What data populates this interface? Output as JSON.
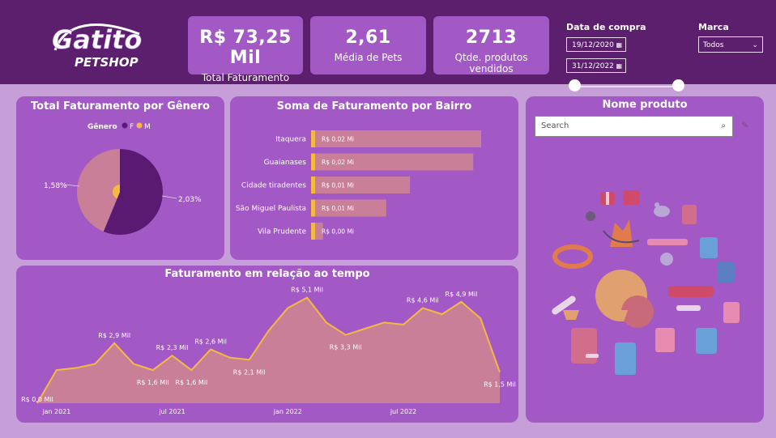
{
  "brand": {
    "name": "Gatito",
    "subname": "PETSHOP"
  },
  "kpis": [
    {
      "value": "R$ 73,25 Mil",
      "label": "Total Faturamento"
    },
    {
      "value": "2,61",
      "label": "Média de Pets"
    },
    {
      "value": "2713",
      "label": "Qtde. produtos vendidos"
    }
  ],
  "filters": {
    "date_title": "Data de compra",
    "date_start": "19/12/2020",
    "date_end": "31/12/2022",
    "brand_title": "Marca",
    "brand_value": "Todos"
  },
  "product_panel": {
    "title": "Nome produto",
    "search_placeholder": "Search"
  },
  "colors": {
    "F": "#5b1a72",
    "M": "#f5b942",
    "bar_fill": "#c97f98",
    "line": "#f5b942"
  },
  "chart_data": [
    {
      "type": "pie",
      "title": "Total Faturamento por Gênero",
      "legend_title": "Gênero",
      "legend_position": "top",
      "categories": [
        "F",
        "M"
      ],
      "values": [
        2.03,
        1.58
      ],
      "value_labels": [
        "2,03%",
        "1,58%"
      ]
    },
    {
      "type": "bar",
      "orientation": "horizontal",
      "title": "Soma de Faturamento por Bairro",
      "categories": [
        "Itaquera",
        "Guaianases",
        "Cidade tiradentes",
        "São Miguel Paulista",
        "Vila Prudente"
      ],
      "values": [
        0.0215,
        0.0205,
        0.0125,
        0.0095,
        0.0015
      ],
      "value_labels": [
        "R$ 0,02 Mi",
        "R$ 0,02 Mi",
        "R$ 0,01 Mi",
        "R$ 0,01 Mi",
        "R$ 0,00 Mi"
      ]
    },
    {
      "type": "area",
      "title": "Faturamento em relação ao tempo",
      "x": [
        "2020-12",
        "2021-01",
        "2021-02",
        "2021-03",
        "2021-04",
        "2021-05",
        "2021-06",
        "2021-07",
        "2021-08",
        "2021-09",
        "2021-10",
        "2021-11",
        "2021-12",
        "2022-01",
        "2022-02",
        "2022-03",
        "2022-04",
        "2022-05",
        "2022-06",
        "2022-07",
        "2022-08",
        "2022-09",
        "2022-10",
        "2022-11",
        "2022-12"
      ],
      "values": [
        0.0,
        1.6,
        1.7,
        1.9,
        2.9,
        1.9,
        1.6,
        2.3,
        1.6,
        2.6,
        2.2,
        2.1,
        3.5,
        4.6,
        5.1,
        3.9,
        3.3,
        3.6,
        3.9,
        3.8,
        4.6,
        4.3,
        4.9,
        4.1,
        1.5
      ],
      "ylim": [
        0,
        5.4
      ],
      "x_ticks": [
        {
          "at": 1,
          "label": "jan 2021"
        },
        {
          "at": 7,
          "label": "jul 2021"
        },
        {
          "at": 13,
          "label": "jan 2022"
        },
        {
          "at": 19,
          "label": "jul 2022"
        }
      ],
      "data_labels": [
        {
          "at": 0,
          "text": "R$ 0,0 Mil"
        },
        {
          "at": 4,
          "text": "R$ 2,9 Mil"
        },
        {
          "at": 6,
          "text": "R$ 1,6 Mil"
        },
        {
          "at": 7,
          "text": "R$ 2,3 Mil"
        },
        {
          "at": 8,
          "text": "R$ 1,6 Mil"
        },
        {
          "at": 9,
          "text": "R$ 2,6 Mil"
        },
        {
          "at": 11,
          "text": "R$ 2,1 Mil"
        },
        {
          "at": 14,
          "text": "R$ 5,1 Mil"
        },
        {
          "at": 16,
          "text": "R$ 3,3 Mil"
        },
        {
          "at": 20,
          "text": "R$ 4,6 Mil"
        },
        {
          "at": 22,
          "text": "R$ 4,9 Mil"
        },
        {
          "at": 24,
          "text": "R$ 1,5 Mil"
        }
      ]
    }
  ]
}
